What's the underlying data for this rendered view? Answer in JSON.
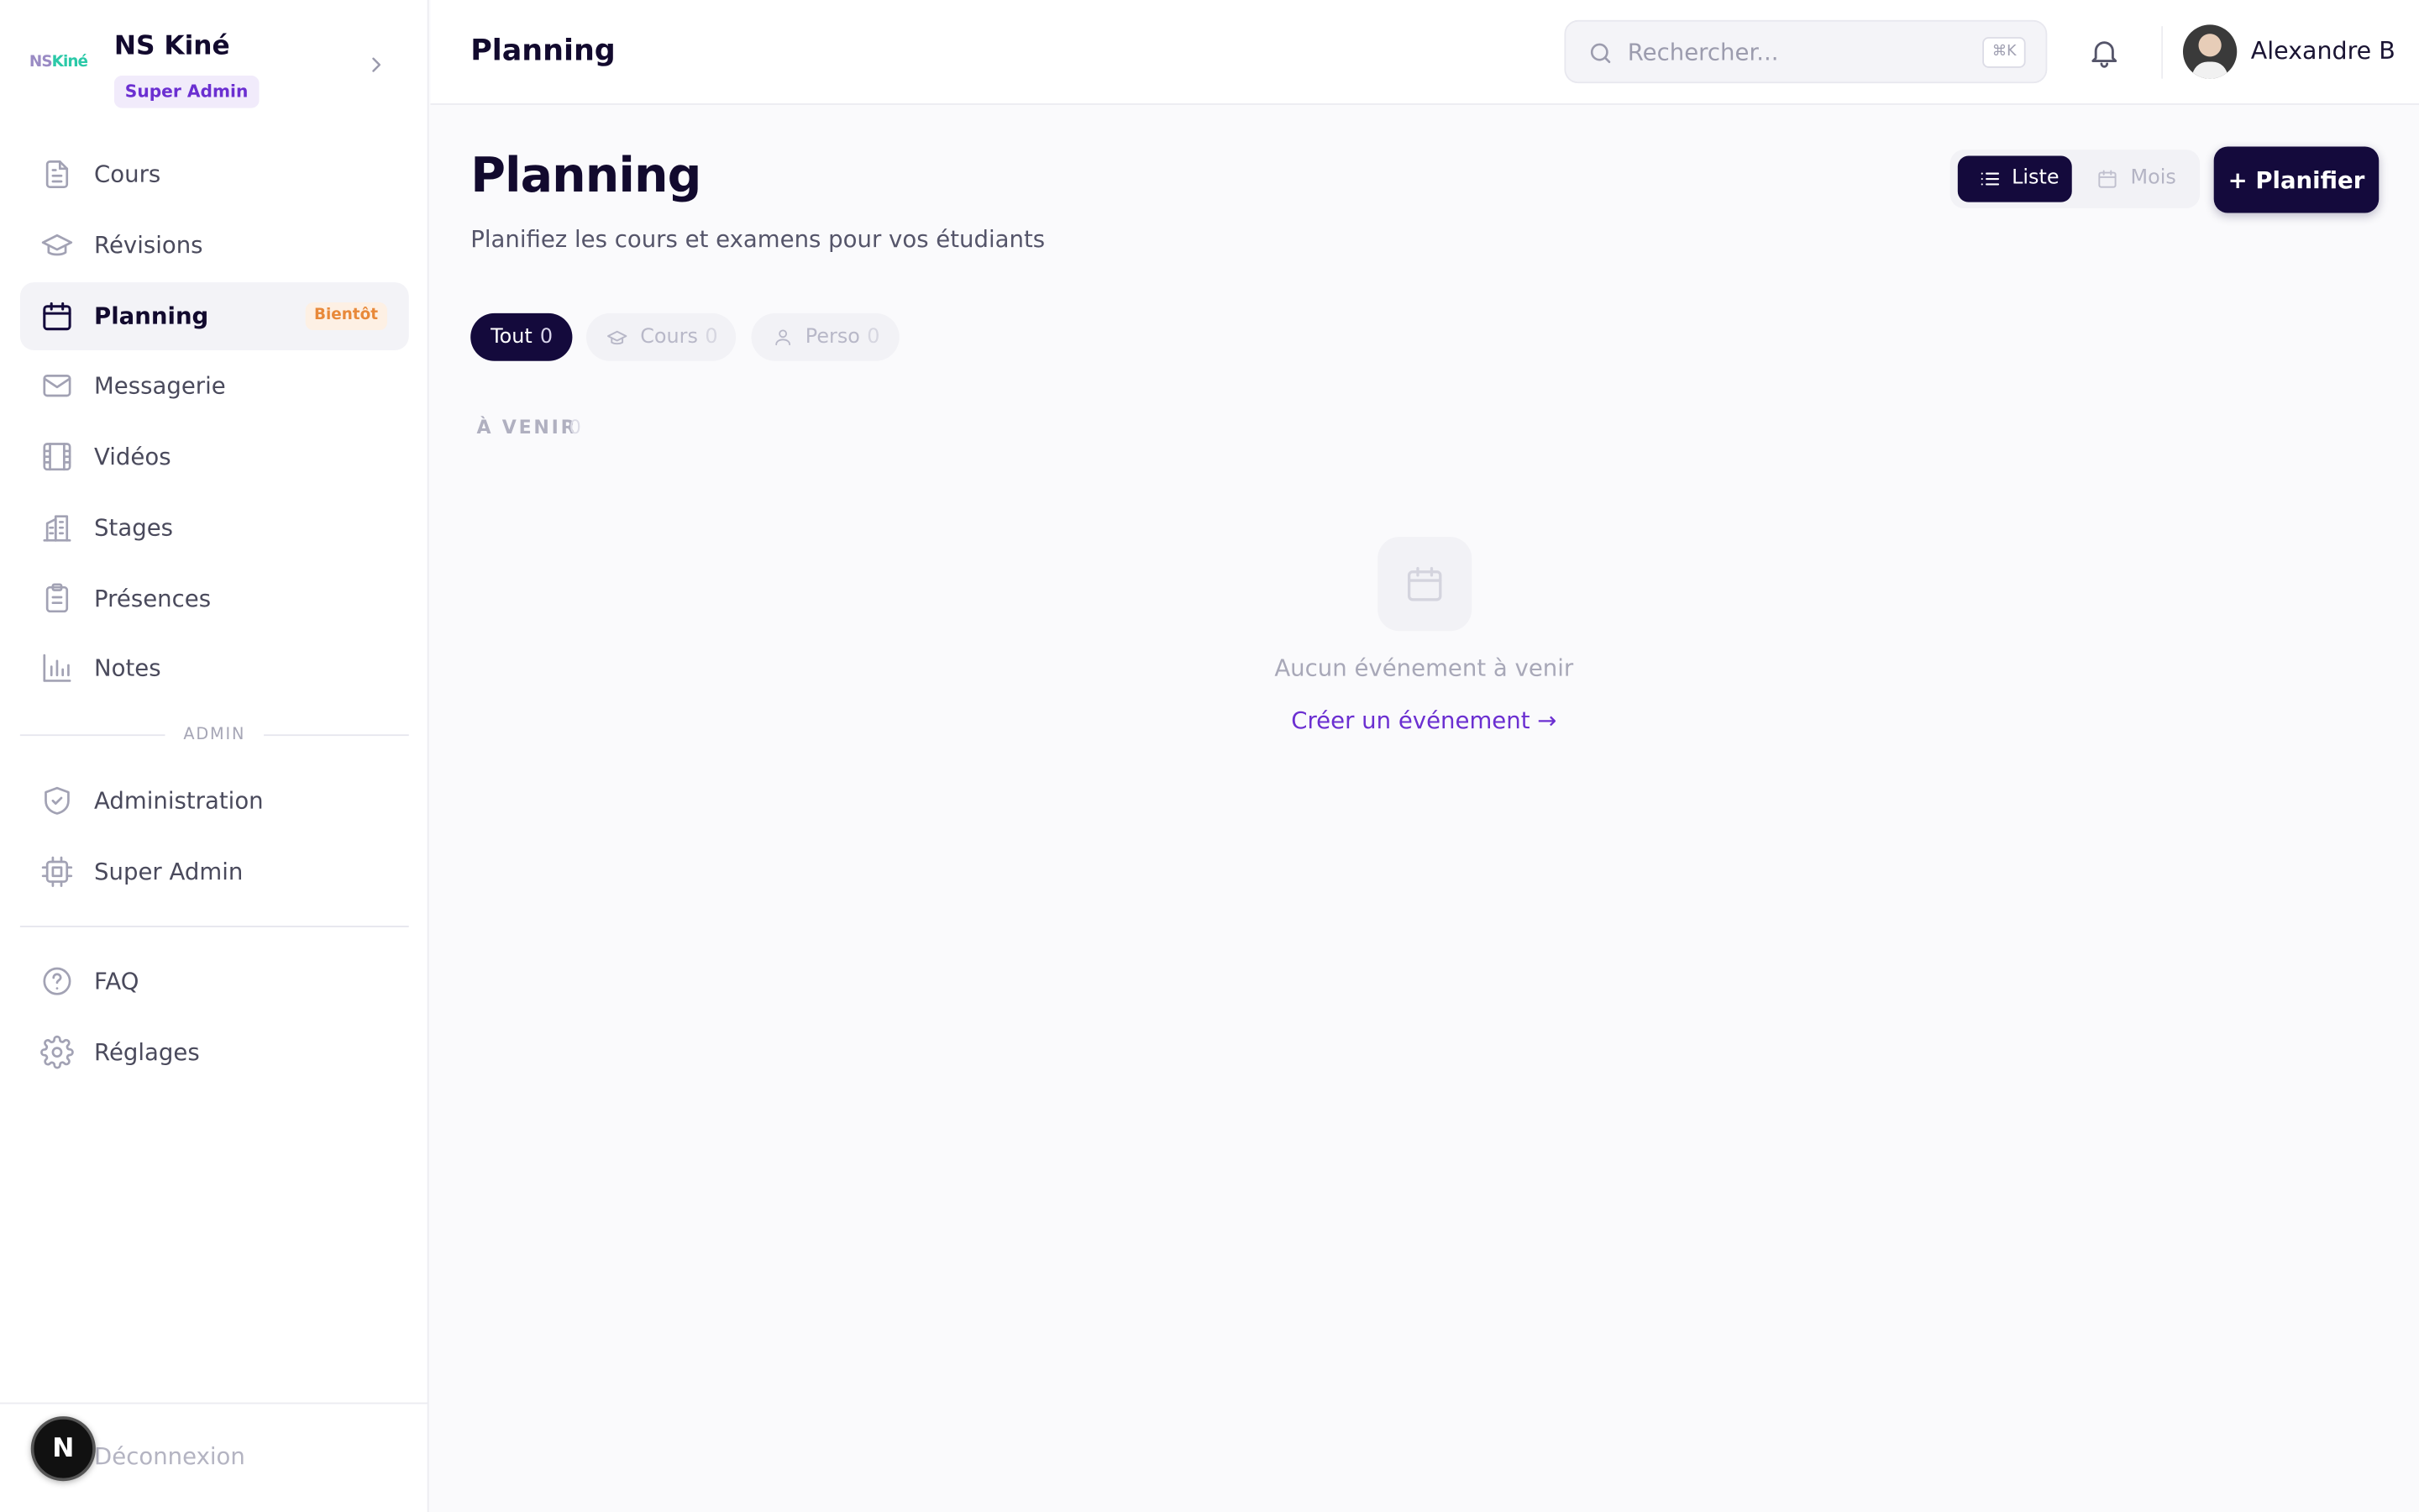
{
  "brand": {
    "logo_ns": "NS",
    "logo_kine": "Kiné",
    "name": "NS Kiné",
    "role_badge": "Super Admin"
  },
  "sidebar": {
    "items": [
      {
        "label": "Cours",
        "icon": "file-text-icon"
      },
      {
        "label": "Révisions",
        "icon": "graduation-cap-icon"
      },
      {
        "label": "Planning",
        "icon": "calendar-icon",
        "badge": "Bientôt",
        "active": true
      },
      {
        "label": "Messagerie",
        "icon": "mail-icon"
      },
      {
        "label": "Vidéos",
        "icon": "film-icon"
      },
      {
        "label": "Stages",
        "icon": "building-icon"
      },
      {
        "label": "Présences",
        "icon": "clipboard-icon"
      },
      {
        "label": "Notes",
        "icon": "bar-chart-icon"
      }
    ],
    "admin_section_label": "ADMIN",
    "admin_items": [
      {
        "label": "Administration",
        "icon": "shield-icon"
      },
      {
        "label": "Super Admin",
        "icon": "cpu-icon"
      }
    ],
    "bottom_items": [
      {
        "label": "FAQ",
        "icon": "help-circle-icon"
      },
      {
        "label": "Réglages",
        "icon": "gear-icon"
      }
    ],
    "logout_label": "Déconnexion",
    "dev_bubble": "N"
  },
  "topbar": {
    "title": "Planning",
    "search_placeholder": "Rechercher...",
    "search_shortcut": "⌘K",
    "user_name": "Alexandre B"
  },
  "main": {
    "title": "Planning",
    "subtitle": "Planifiez les cours et examens pour vos étudiants",
    "view_toggle": {
      "list": "Liste",
      "month": "Mois",
      "selected": "Liste"
    },
    "plan_button": "+ Planifier",
    "filters": [
      {
        "label": "Tout",
        "count": "0",
        "active": true
      },
      {
        "label": "Cours",
        "count": "0"
      },
      {
        "label": "Perso",
        "count": "0"
      }
    ],
    "upcoming_label": "À VENIR",
    "upcoming_count": "0",
    "empty_text": "Aucun événement à venir",
    "create_link": "Créer un événement →"
  },
  "colors": {
    "primary": "#140a3c",
    "accent": "#6b2fd1",
    "soon_badge": "#e8893a",
    "background": "#fafafc"
  }
}
